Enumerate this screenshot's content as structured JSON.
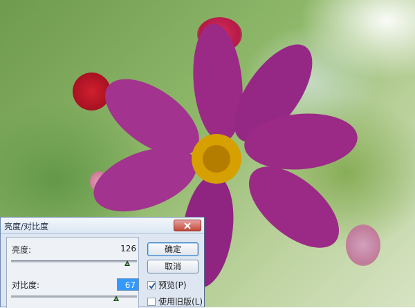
{
  "dialog": {
    "title": "亮度/对比度",
    "brightness": {
      "label": "亮度:",
      "value": "126",
      "slider_fraction": 0.93
    },
    "contrast": {
      "label": "对比度:",
      "value": "67",
      "slider_fraction": 0.79
    },
    "buttons": {
      "ok": "确定",
      "cancel": "取消"
    },
    "options": {
      "preview": {
        "label": "预览(P)",
        "checked": true
      },
      "use_legacy": {
        "label": "使用旧版(L)",
        "checked": false
      }
    }
  },
  "icons": {
    "close": "close-icon",
    "slider_thumb": "triangle-up-icon",
    "check": "checkmark-icon"
  },
  "colors": {
    "dialog_bg": "#dde6f1",
    "selection": "#3399ff",
    "close_button": "#c24b3a"
  }
}
